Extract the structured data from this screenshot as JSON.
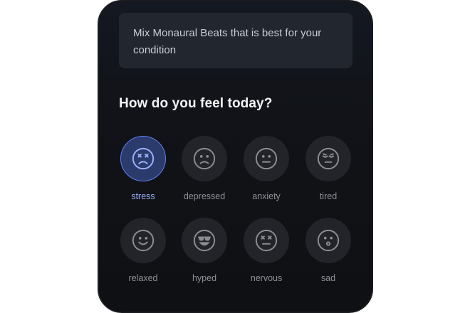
{
  "intro": {
    "line1": "Mix Monaural Beats that is best for your",
    "line2": "condition"
  },
  "question": "How do you feel today?",
  "moods": [
    {
      "label": "stress",
      "icon": "stress-face-icon",
      "selected": true
    },
    {
      "label": "depressed",
      "icon": "sad-face-icon",
      "selected": false
    },
    {
      "label": "anxiety",
      "icon": "neutral-face-icon",
      "selected": false
    },
    {
      "label": "tired",
      "icon": "tired-face-icon",
      "selected": false
    },
    {
      "label": "relaxed",
      "icon": "smile-face-icon",
      "selected": false
    },
    {
      "label": "hyped",
      "icon": "sunglasses-face-icon",
      "selected": false
    },
    {
      "label": "nervous",
      "icon": "nervous-face-icon",
      "selected": false
    },
    {
      "label": "sad",
      "icon": "surprised-face-icon",
      "selected": false
    }
  ],
  "colors": {
    "accent": "#5f7ef0",
    "accent_label": "#9cb1ff",
    "background": "#111318"
  }
}
